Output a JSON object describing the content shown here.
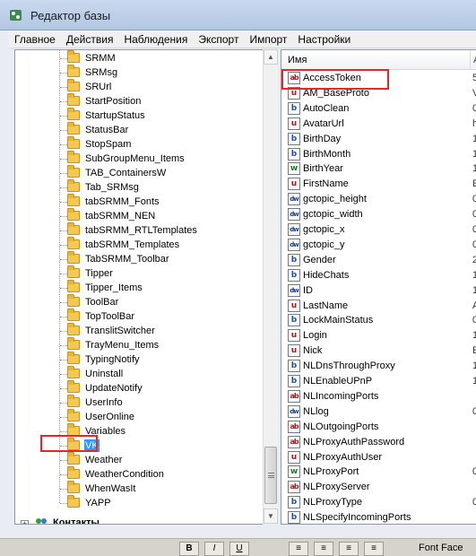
{
  "window": {
    "title": "Редактор базы"
  },
  "menu": [
    "Главное",
    "Действия",
    "Наблюдения",
    "Экспорт",
    "Импорт",
    "Настройки"
  ],
  "tree": {
    "items": [
      "SRMM",
      "SRMsg",
      "SRUrl",
      "StartPosition",
      "StartupStatus",
      "StatusBar",
      "StopSpam",
      "SubGroupMenu_Items",
      "TAB_ContainersW",
      "Tab_SRMsg",
      "tabSRMM_Fonts",
      "tabSRMM_NEN",
      "tabSRMM_RTLTemplates",
      "tabSRMM_Templates",
      "TabSRMM_Toolbar",
      "Tipper",
      "Tipper_Items",
      "ToolBar",
      "TopToolBar",
      "TranslitSwitcher",
      "TrayMenu_Items",
      "TypingNotify",
      "Uninstall",
      "UpdateNotify",
      "UserInfo",
      "UserOnline",
      "Variables",
      "VK",
      "Weather",
      "WeatherCondition",
      "WhenWasIt",
      "YAPP"
    ],
    "selected": "VK",
    "contacts_label": "Контакты",
    "expand_glyph": "+"
  },
  "values": {
    "column_name": "Имя",
    "column_next": "А",
    "rows": [
      {
        "type": "ab",
        "name": "AccessToken",
        "cut": "5"
      },
      {
        "type": "u",
        "name": "AM_BaseProto",
        "cut": "V"
      },
      {
        "type": "b",
        "name": "AutoClean",
        "cut": "0"
      },
      {
        "type": "u",
        "name": "AvatarUrl",
        "cut": "h"
      },
      {
        "type": "b",
        "name": "BirthDay",
        "cut": "1"
      },
      {
        "type": "b",
        "name": "BirthMonth",
        "cut": "1"
      },
      {
        "type": "w",
        "name": "BirthYear",
        "cut": "1"
      },
      {
        "type": "u",
        "name": "FirstName",
        "cut": "E"
      },
      {
        "type": "dw",
        "name": "gctopic_height",
        "cut": "0"
      },
      {
        "type": "dw",
        "name": "gctopic_width",
        "cut": "0"
      },
      {
        "type": "dw",
        "name": "gctopic_x",
        "cut": "0"
      },
      {
        "type": "dw",
        "name": "gctopic_y",
        "cut": "0"
      },
      {
        "type": "b",
        "name": "Gender",
        "cut": "2"
      },
      {
        "type": "b",
        "name": "HideChats",
        "cut": "1"
      },
      {
        "type": "dw",
        "name": "ID",
        "cut": "1"
      },
      {
        "type": "u",
        "name": "LastName",
        "cut": "A"
      },
      {
        "type": "b",
        "name": "LockMainStatus",
        "cut": "0"
      },
      {
        "type": "u",
        "name": "Login",
        "cut": "1"
      },
      {
        "type": "u",
        "name": "Nick",
        "cut": "E"
      },
      {
        "type": "b",
        "name": "NLDnsThroughProxy",
        "cut": "1"
      },
      {
        "type": "b",
        "name": "NLEnableUPnP",
        "cut": "1"
      },
      {
        "type": "ab",
        "name": "NLIncomingPorts",
        "cut": ""
      },
      {
        "type": "dw",
        "name": "NLlog",
        "cut": "0"
      },
      {
        "type": "ab",
        "name": "NLOutgoingPorts",
        "cut": ""
      },
      {
        "type": "ab",
        "name": "NLProxyAuthPassword",
        "cut": ""
      },
      {
        "type": "u",
        "name": "NLProxyAuthUser",
        "cut": ""
      },
      {
        "type": "w",
        "name": "NLProxyPort",
        "cut": "0"
      },
      {
        "type": "ab",
        "name": "NLProxyServer",
        "cut": ""
      },
      {
        "type": "b",
        "name": "NLProxyType",
        "cut": "0"
      },
      {
        "type": "b",
        "name": "NLSpecifyIncomingPorts",
        "cut": ""
      }
    ],
    "type_glyphs": {
      "ab": "ab",
      "u": "u",
      "b": "b",
      "w": "w",
      "dw": "dw"
    }
  },
  "bottom_toolbar": {
    "font_face_label": "Font Face",
    "buttons": [
      "B",
      "I",
      "U",
      "≡",
      "≡",
      "≡",
      "≡"
    ]
  }
}
